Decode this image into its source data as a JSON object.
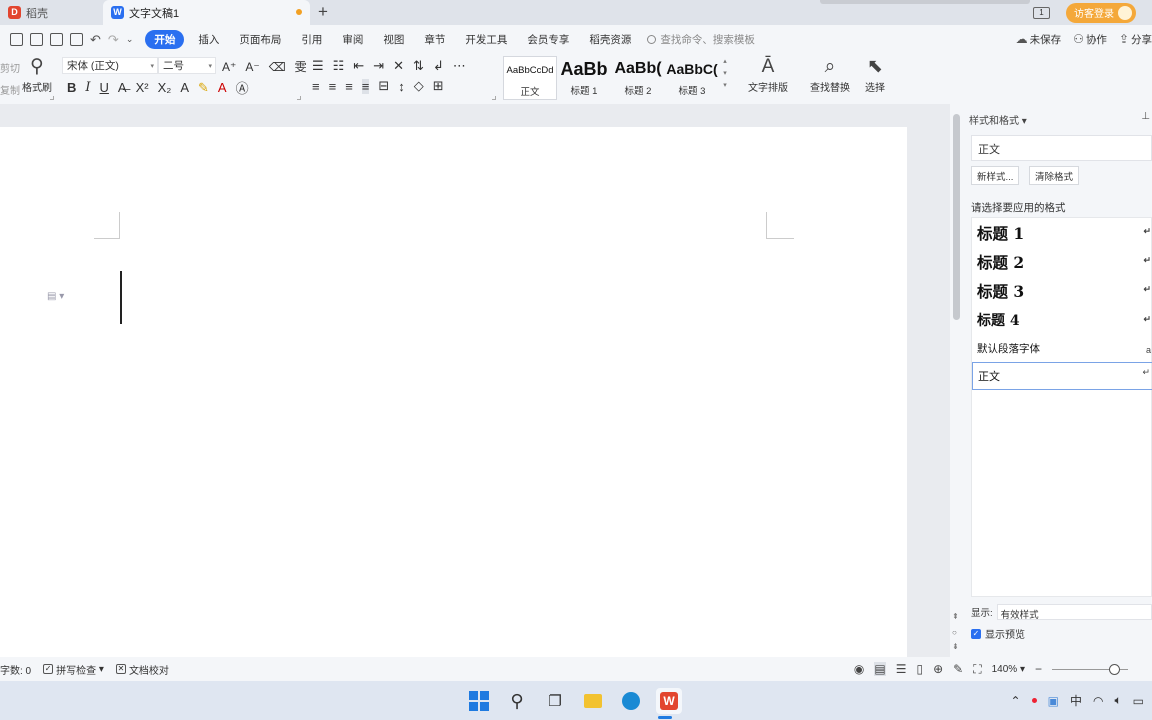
{
  "tabs": [
    {
      "label": "稻壳",
      "icon": "docer-icon"
    },
    {
      "label": "文字文稿1",
      "icon": "wps-writer-icon"
    }
  ],
  "top_right": {
    "page_badge": "1",
    "login": "访客登录"
  },
  "menu": {
    "items": [
      "开始",
      "插入",
      "页面布局",
      "引用",
      "审阅",
      "视图",
      "章节",
      "开发工具",
      "会员专享",
      "稻壳资源"
    ],
    "active": "开始",
    "search_placeholder": "查找命令、搜索模板",
    "unsaved": "未保存",
    "collab": "协作",
    "share": "分享"
  },
  "ribbon": {
    "cut": "剪切",
    "copy": "复制",
    "format_painter": "格式刷",
    "font_name": "宋体 (正文)",
    "font_size": "二号",
    "styles": [
      {
        "preview": "AaBbCcDd",
        "name": "正文"
      },
      {
        "preview": "AaBb",
        "name": "标题 1"
      },
      {
        "preview": "AaBb(",
        "name": "标题 2"
      },
      {
        "preview": "AaBbC(",
        "name": "标题 3"
      }
    ],
    "text_layout": "文字排版",
    "find_replace": "查找替换",
    "select": "选择"
  },
  "panel": {
    "title": "样式和格式",
    "current_style": "正文",
    "new_style": "新样式...",
    "clear_format": "清除格式",
    "pick_label": "请选择要应用的格式",
    "styles": [
      {
        "label": "标题 1",
        "kind": "heading"
      },
      {
        "label": "标题 2",
        "kind": "heading"
      },
      {
        "label": "标题 3",
        "kind": "heading"
      },
      {
        "label": "标题 4",
        "kind": "heading"
      },
      {
        "label": "默认段落字体",
        "kind": "small"
      },
      {
        "label": "正文",
        "kind": "selected"
      }
    ],
    "show_label": "显示:",
    "show_value": "有效样式",
    "preview_label": "显示预览"
  },
  "status": {
    "word_count": "字数: 0",
    "spell_check": "拼写检查",
    "doc_proof": "文档校对",
    "zoom": "140%"
  },
  "taskbar": {
    "ime": "中"
  },
  "colors": {
    "accent": "#2a6ff0",
    "login_bg": "#f4a83a",
    "unsaved_dot": "#f2a023"
  }
}
